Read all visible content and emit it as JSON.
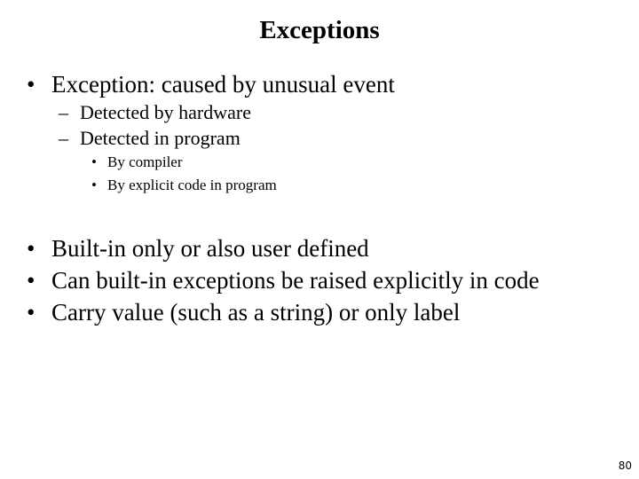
{
  "slide": {
    "title": "Exceptions",
    "bullets": [
      {
        "marker": "•",
        "text": "Exception: caused by unusual event"
      },
      {
        "marker": "–",
        "text": "Detected by hardware"
      },
      {
        "marker": "–",
        "text": "Detected in program"
      },
      {
        "marker": "•",
        "text": "By compiler"
      },
      {
        "marker": "•",
        "text": "By explicit code in program"
      },
      {
        "marker": "•",
        "text": "Built-in only or also user defined"
      },
      {
        "marker": "•",
        "text": "Can built-in exceptions be raised explicitly in code"
      },
      {
        "marker": "•",
        "text": "Carry value (such as a string) or only label"
      }
    ],
    "page_number": "80"
  }
}
